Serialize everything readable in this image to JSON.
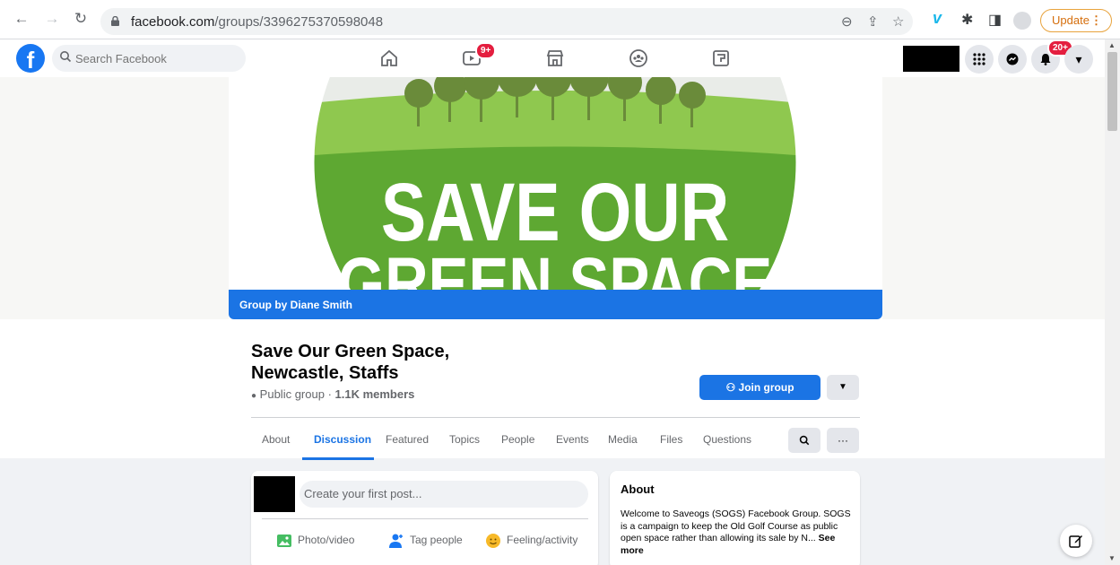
{
  "browser": {
    "url_host": "facebook.com",
    "url_path": "/groups/3396275370598048",
    "update_label": "Update"
  },
  "topbar": {
    "search_placeholder": "Search Facebook",
    "watch_badge": "9+",
    "notif_badge": "20+"
  },
  "cover": {
    "line1": "SAVE OUR",
    "line2": "GREEN SPACE",
    "owner_label": "Group by Diane Smith",
    "brand_green": "#6ab43e"
  },
  "group": {
    "title": "Save Our Green Space, Newcastle, Staffs",
    "privacy": "Public group",
    "separator": " · ",
    "members": "1.1K members",
    "join_label": "Join group"
  },
  "tabs": [
    {
      "label": "About"
    },
    {
      "label": "Discussion"
    },
    {
      "label": "Featured"
    },
    {
      "label": "Topics"
    },
    {
      "label": "People"
    },
    {
      "label": "Events"
    },
    {
      "label": "Media"
    },
    {
      "label": "Files"
    },
    {
      "label": "Questions"
    }
  ],
  "composer": {
    "placeholder": "Create your first post...",
    "actions": [
      {
        "label": "Photo/video"
      },
      {
        "label": "Tag people"
      },
      {
        "label": "Feeling/activity"
      }
    ]
  },
  "about": {
    "title": "About",
    "text": "Welcome to Saveogs (SOGS) Facebook Group. SOGS is a campaign to keep the Old Golf Course as public open space rather than allowing its sale by N...",
    "see_more": "See more"
  }
}
